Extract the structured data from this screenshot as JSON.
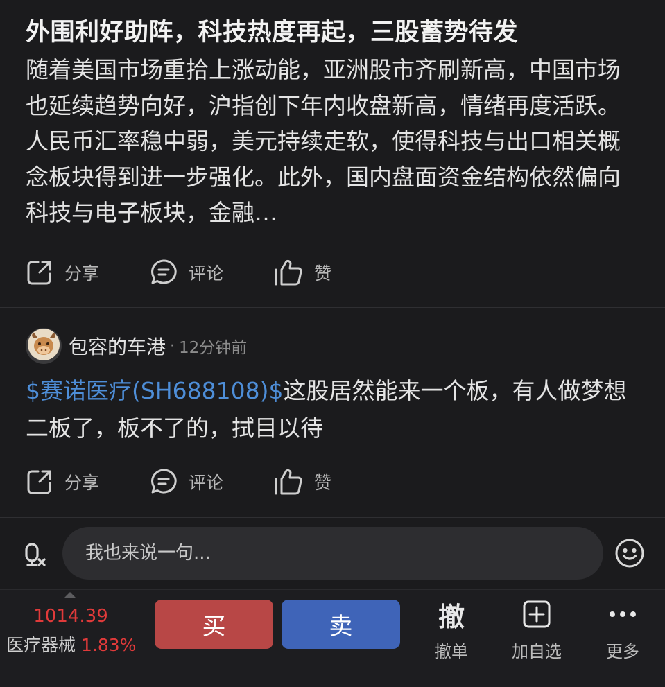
{
  "post1": {
    "title": "外围利好助阵，科技热度再起，三股蓄势待发",
    "body": "随着美国市场重拾上涨动能，亚洲股市齐刷新高，中国市场也延续趋势向好，沪指创下年内收盘新高，情绪再度活跃。人民币汇率稳中弱，美元持续走软，使得科技与出口相关概念板块得到进一步强化。此外，国内盘面资金结构依然偏向科技与电子板块，金融…",
    "actions": {
      "share": "分享",
      "comment": "评论",
      "like": "赞"
    }
  },
  "post2": {
    "author": "包容的车港",
    "separator": "·",
    "time": "12分钟前",
    "stock_link": "$赛诺医疗(SH688108)$",
    "text": "这股居然能来一个板，有人做梦想二板了，板不了的，拭目以待",
    "actions": {
      "share": "分享",
      "comment": "评论",
      "like": "赞"
    }
  },
  "comment_bar": {
    "placeholder": "我也来说一句..."
  },
  "trade_bar": {
    "index_price": "1014.39",
    "index_name": "医疗器械",
    "index_change": "1.83%",
    "buy_label": "买",
    "sell_label": "卖",
    "cancel_glyph": "撤",
    "cancel_label": "撤单",
    "watch_label": "加自选",
    "more_label": "更多"
  },
  "colors": {
    "background": "#1b1b1d",
    "link": "#4e8ed8",
    "up_red": "#e03a3a",
    "buy": "#b84746",
    "sell": "#3f64b8"
  },
  "icons": [
    "share-icon",
    "comment-icon",
    "thumbs-up-icon",
    "avatar-icon",
    "voice-icon",
    "emoji-icon",
    "add-watchlist-icon",
    "more-icon"
  ]
}
